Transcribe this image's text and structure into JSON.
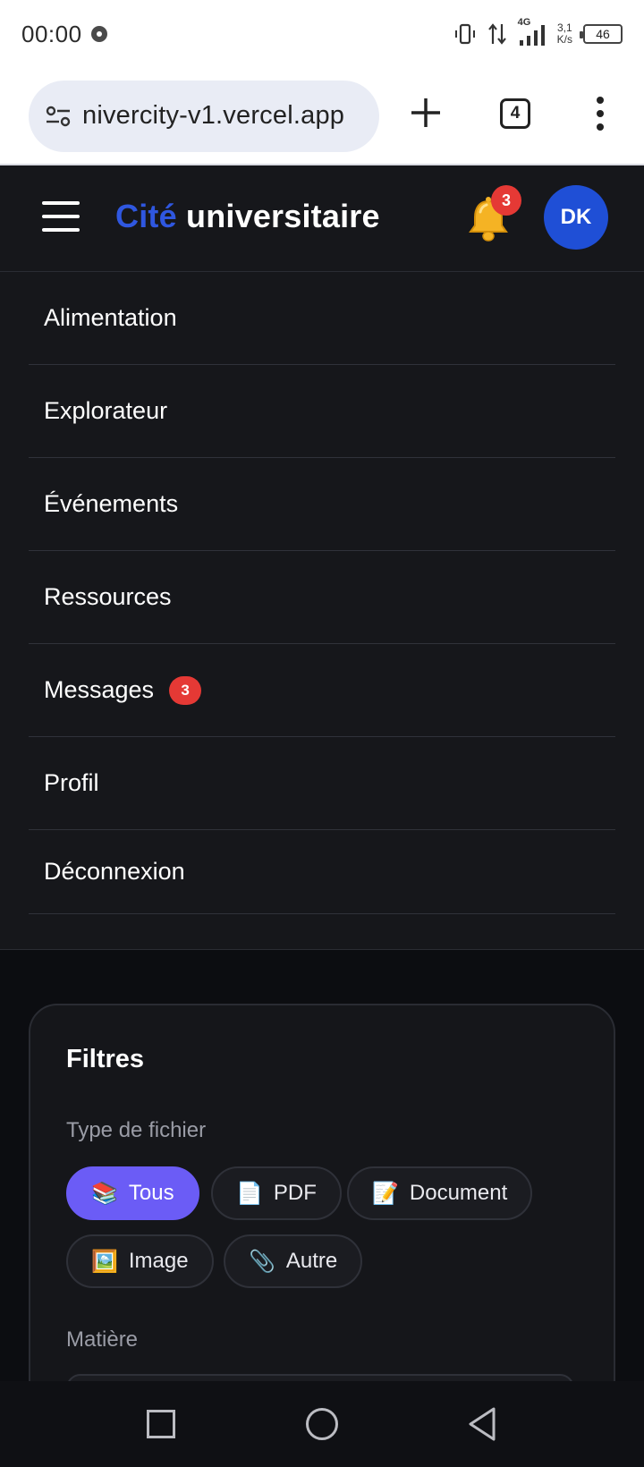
{
  "status_bar": {
    "time": "00:00",
    "network": "4G",
    "speed_value": "3,1",
    "speed_unit": "K/s",
    "battery": "46"
  },
  "browser": {
    "url": "nivercity-v1.vercel.app",
    "tab_count": "4"
  },
  "header": {
    "brand_accent": "Cité",
    "brand_rest": " universitaire",
    "notification_count": "3",
    "avatar_initials": "DK",
    "brand_color": "#2f57e0",
    "avatar_color": "#1f4fd6",
    "badge_color": "#e53935"
  },
  "nav_menu": {
    "items": [
      {
        "label": "Alimentation"
      },
      {
        "label": "Explorateur"
      },
      {
        "label": "Événements"
      },
      {
        "label": "Ressources"
      },
      {
        "label": "Messages",
        "badge": "3"
      },
      {
        "label": "Profil"
      },
      {
        "label": "Déconnexion"
      }
    ]
  },
  "filters": {
    "title": "Filtres",
    "file_type_label": "Type de fichier",
    "chips": [
      {
        "icon": "📚",
        "label": "Tous",
        "active": true
      },
      {
        "icon": "📄",
        "label": "PDF",
        "active": false
      },
      {
        "icon": "📝",
        "label": "Document",
        "active": false
      },
      {
        "icon": "🖼️",
        "label": "Image",
        "active": false
      },
      {
        "icon": "📎",
        "label": "Autre",
        "active": false
      }
    ],
    "subject_label": "Matière",
    "active_chip_color": "#6b5cf6"
  }
}
